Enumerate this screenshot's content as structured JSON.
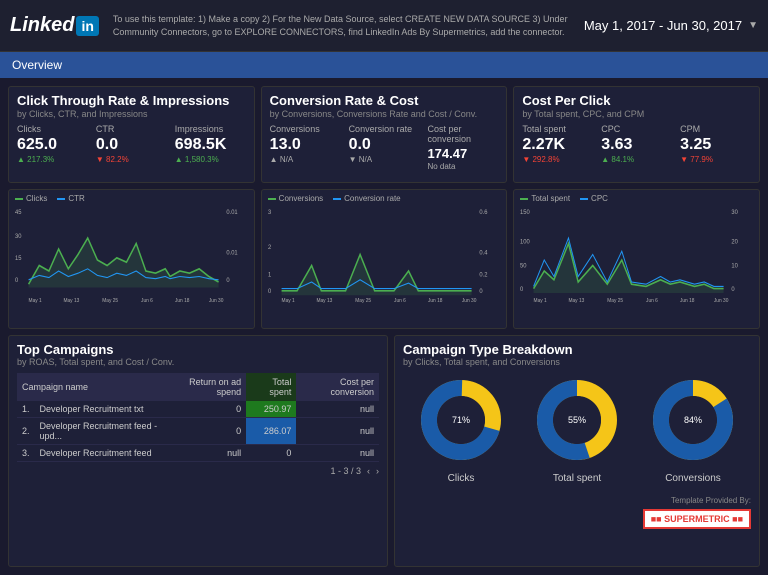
{
  "header": {
    "logo_text": "Linked",
    "logo_in": "in",
    "instructions": "To use this template: 1) Make a copy 2) For the New Data Source, select CREATE NEW DATA SOURCE 3) Under Community Connectors, go to EXPLORE CONNECTORS, find LinkedIn Ads By Supermetrics, add the connector.",
    "date_range": "May 1, 2017 - Jun 30, 2017"
  },
  "nav": {
    "label": "Overview"
  },
  "ctr_panel": {
    "title": "Click Through Rate & Impressions",
    "subtitle": "by Clicks, CTR, and Impressions",
    "metrics": [
      {
        "label": "Clicks",
        "value": "625.0",
        "change": "▲ 217.3%",
        "type": "positive"
      },
      {
        "label": "CTR",
        "value": "0.0",
        "change": "▼ 82.2%",
        "type": "negative"
      },
      {
        "label": "Impressions",
        "value": "698.5K",
        "change": "▲ 1,580.3%",
        "type": "positive"
      }
    ],
    "legend": [
      {
        "label": "Clicks",
        "color": "#4caf50"
      },
      {
        "label": "CTR",
        "color": "#2196f3"
      }
    ]
  },
  "conversion_panel": {
    "title": "Conversion Rate & Cost",
    "subtitle": "by Conversions, Conversions Rate and Cost / Conv.",
    "metrics": [
      {
        "label": "Conversions",
        "value": "13.0",
        "change": "▲ N/A",
        "type": "neutral"
      },
      {
        "label": "Conversion rate",
        "value": "0.0",
        "change": "▼ N/A",
        "type": "neutral"
      },
      {
        "label": "Cost per conversion",
        "value": "174.47",
        "change": "No data",
        "type": "neutral"
      }
    ],
    "legend": [
      {
        "label": "Conversions",
        "color": "#4caf50"
      },
      {
        "label": "Conversion rate",
        "color": "#2196f3"
      }
    ]
  },
  "cpc_panel": {
    "title": "Cost Per Click",
    "subtitle": "by Total spent, CPC, and CPM",
    "metrics": [
      {
        "label": "Total spent",
        "value": "2.27K",
        "change": "▼ 292.8%",
        "type": "negative"
      },
      {
        "label": "CPC",
        "value": "3.63",
        "change": "▲ 84.1%",
        "type": "positive"
      },
      {
        "label": "CPM",
        "value": "3.25",
        "change": "▼ 77.9%",
        "type": "negative"
      }
    ],
    "legend": [
      {
        "label": "Total spent",
        "color": "#4caf50"
      },
      {
        "label": "CPC",
        "color": "#2196f3"
      }
    ]
  },
  "x_labels": [
    "May 1",
    "May 13",
    "May 25",
    "Jun 6",
    "Jun 18",
    "Jun 30"
  ],
  "campaigns": {
    "title": "Top Campaigns",
    "subtitle": "by ROAS, Total spent, and Cost / Conv.",
    "columns": [
      "Campaign name",
      "Return on ad spend",
      "Total spent",
      "Cost per conversion"
    ],
    "rows": [
      {
        "num": "1.",
        "name": "Developer Recruitment txt",
        "roas": "0",
        "spent": "250.97",
        "conv": "null",
        "spent_highlight": "green"
      },
      {
        "num": "2.",
        "name": "Developer Recruitment feed - upd...",
        "roas": "0",
        "spent": "286.07",
        "conv": "null",
        "spent_highlight": "blue"
      },
      {
        "num": "3.",
        "name": "Developer Recruitment feed",
        "roas": "null",
        "spent": "0",
        "conv": "null",
        "spent_highlight": "none"
      }
    ],
    "pagination": "1 - 3 / 3"
  },
  "breakdown": {
    "title": "Campaign Type Breakdown",
    "subtitle": "by Clicks, Total spent, and Conversions",
    "items": [
      {
        "label": "Clicks",
        "blue_pct": 71,
        "gold_pct": 29
      },
      {
        "label": "Total spent",
        "blue_pct": 55,
        "gold_pct": 45
      },
      {
        "label": "Conversions",
        "blue_pct": 84,
        "gold_pct": 16
      }
    ]
  },
  "template_by": "Template Provided By:",
  "supermetrics_label": "SUPERMETRIC"
}
